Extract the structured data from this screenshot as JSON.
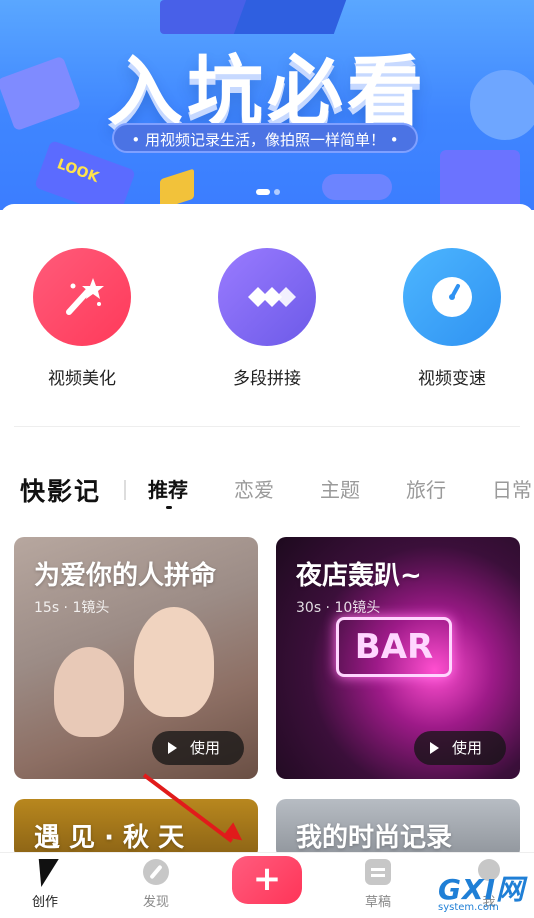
{
  "banner": {
    "title": "入坑必看",
    "subtitle": "• 用视频记录生活，像拍照一样简单！ •",
    "deco_text": "LOOK"
  },
  "tools": [
    {
      "label": "视频美化",
      "icon": "magic-wand-icon"
    },
    {
      "label": "多段拼接",
      "icon": "diamonds-icon"
    },
    {
      "label": "视频变速",
      "icon": "speedometer-icon"
    }
  ],
  "tabs": {
    "brand": "快影记",
    "items": [
      "推荐",
      "恋爱",
      "主题",
      "旅行",
      "日常"
    ],
    "active_index": 0
  },
  "cards": [
    {
      "title": "为爱你的人拼命",
      "meta": "15s · 1镜头",
      "button": "使用"
    },
    {
      "title": "夜店轰趴~",
      "meta": "30s · 10镜头",
      "button": "使用",
      "neon": "BAR"
    },
    {
      "title": "遇 见 · 秋 天"
    },
    {
      "title": "我的时尚记录"
    }
  ],
  "bottom_nav": {
    "items": [
      {
        "label": "创作",
        "icon": "lightning-icon",
        "active": true
      },
      {
        "label": "发现",
        "icon": "compass-icon"
      },
      {
        "label": "草稿",
        "icon": "draft-icon"
      },
      {
        "label": "我",
        "icon": "profile-icon"
      }
    ],
    "create_label": "+"
  },
  "watermark": {
    "main": "GXI网",
    "sub": "system.com"
  },
  "colors": {
    "banner_blue": "#3f86ff",
    "accent_red": "#ff3a5a",
    "purple": "#6c5ae8",
    "blue": "#2f92f2",
    "annotation_red": "#e11b1b"
  }
}
